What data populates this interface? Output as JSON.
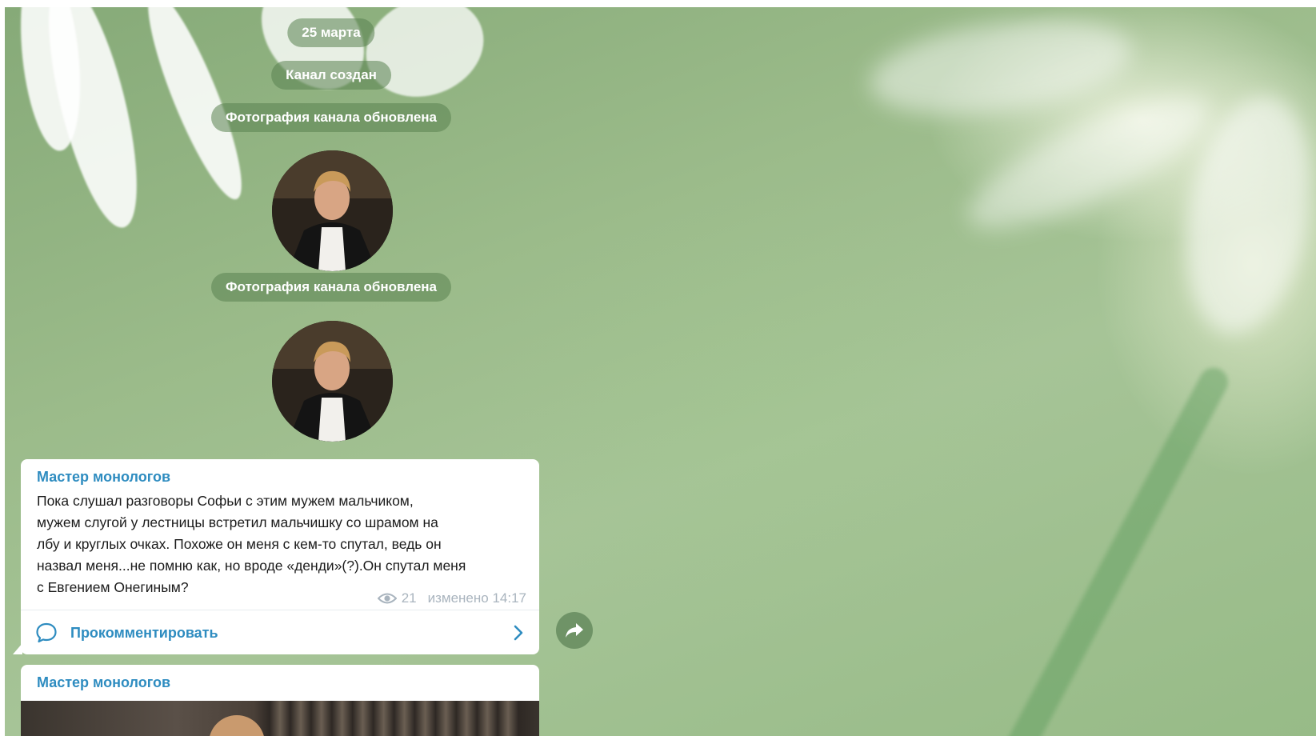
{
  "chat": {
    "service_messages": [
      {
        "text": "25 марта"
      },
      {
        "text": "Канал создан"
      },
      {
        "text": "Фотография канала обновлена"
      },
      {
        "text": "Фотография канала обновлена"
      }
    ],
    "posts": [
      {
        "author": "Мастер монологов",
        "text_lines": [
          "Пока слушал разговоры Софьи с этим мужем мальчиком,",
          "мужем слугой у лестницы встретил мальчишку со шрамом на",
          "лбу и круглых очках. Похоже он меня с кем-то спутал, ведь он",
          "назвал меня...не помню как, но вроде «денди»(?).Он спутал меня",
          "с Евгением Онегиным?"
        ],
        "views": "21",
        "edited": "изменено 14:17",
        "comment_label": "Прокомментировать"
      },
      {
        "author": "Мастер монологов"
      }
    ]
  },
  "icons": {
    "views": "eye-icon",
    "comment": "comment-bubble-icon",
    "chevron": "chevron-right-icon",
    "forward": "forward-arrow-icon"
  },
  "colors": {
    "accent": "#2e8cc0",
    "service_pill": "#6a9560",
    "meta": "#a9b4be"
  }
}
